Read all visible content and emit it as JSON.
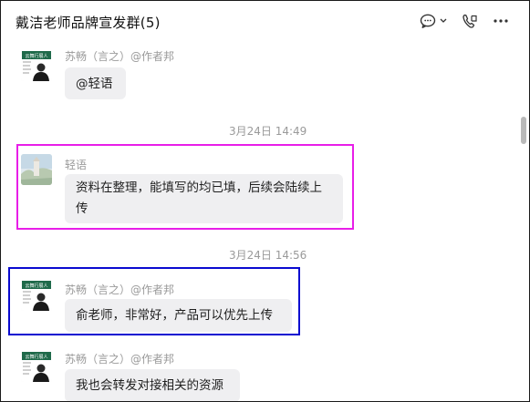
{
  "header": {
    "title": "戴洁老师品牌宣发群(5)",
    "icons": [
      "chat-bubble-icon",
      "chevron-down-icon",
      "voice-call-icon",
      "more-icon"
    ]
  },
  "messages": [
    {
      "sender": "苏畅（言之）@作者邦",
      "text": "@轻语",
      "avatar": "bookstore-profile"
    },
    {
      "time": "3月24日 14:49"
    },
    {
      "sender": "轻语",
      "text_line1": "资料在整理，能填写的均已填，后续会陆续上",
      "text_line2": "传",
      "avatar": "landscape-photo"
    },
    {
      "time": "3月24日 14:56"
    },
    {
      "sender": "苏畅（言之）@作者邦",
      "text": "俞老师，非常好，产品可以优先上传",
      "avatar": "bookstore-profile"
    },
    {
      "sender": "苏畅（言之）@作者邦",
      "text": "我也会转发对接相关的资源",
      "avatar": "bookstore-profile"
    }
  ],
  "avatar_label": "云舞行展人",
  "colors": {
    "highlight_1": "#e81ee8",
    "highlight_2": "#0a0ad0",
    "bubble": "#efeff1",
    "meta_text": "#9a9a9a"
  }
}
